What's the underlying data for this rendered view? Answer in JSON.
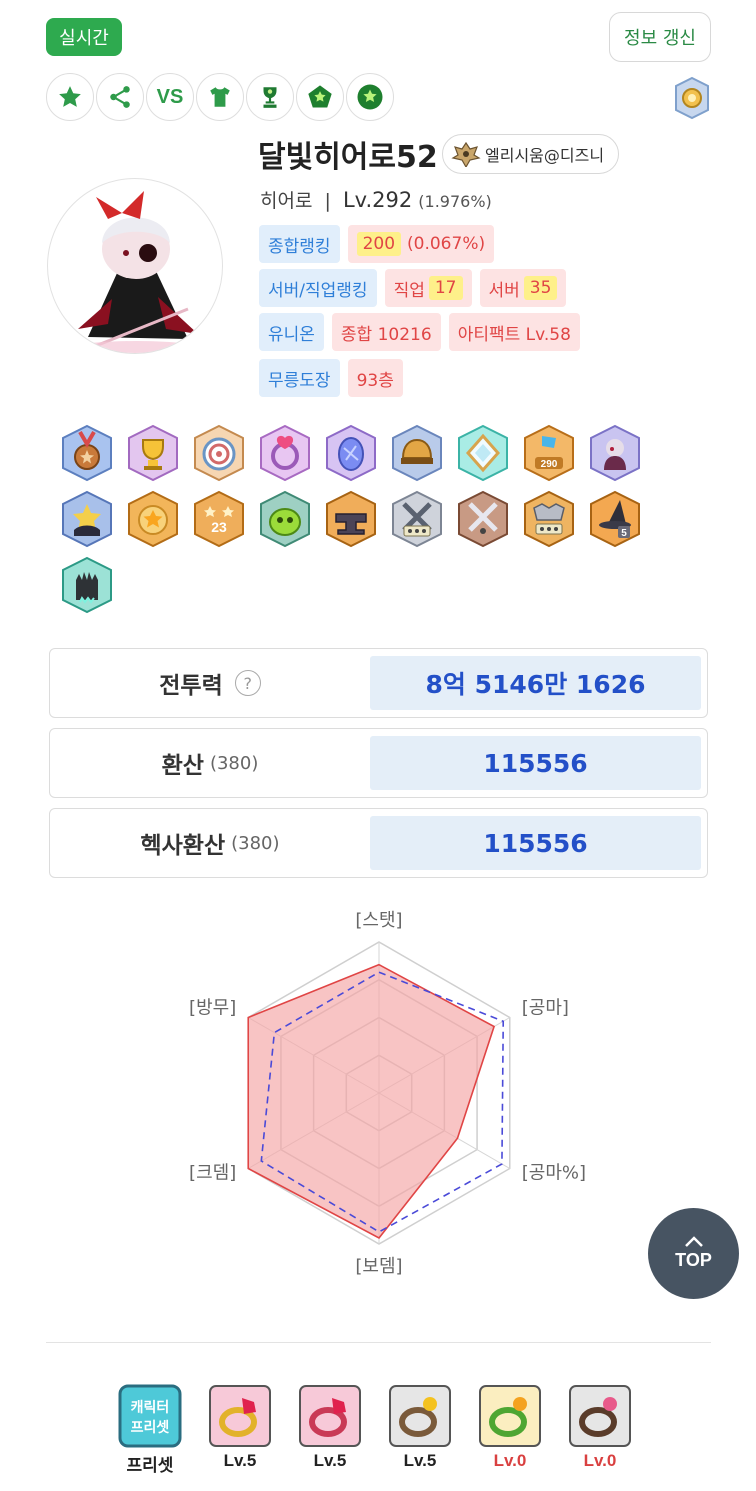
{
  "header": {
    "realtime_label": "실시간",
    "refresh_label": "정보 갱신",
    "quick_icons": [
      {
        "icon": "star-icon"
      },
      {
        "icon": "share-icon"
      },
      {
        "icon": "vs-icon",
        "text": "VS"
      },
      {
        "icon": "shirt-icon"
      },
      {
        "icon": "trophy-icon"
      },
      {
        "icon": "pentagon-icon"
      },
      {
        "icon": "circle-star-icon"
      }
    ]
  },
  "character": {
    "name": "달빛히어로52",
    "guild": "엘리시움@디즈니",
    "job": "히어로",
    "separator": "|",
    "level": "Lv.292",
    "exp_percent": "(1.976%)"
  },
  "rankings": {
    "overall_label": "종합랭킹",
    "overall_rank": "200",
    "overall_percent": "(0.067%)",
    "server_job_label": "서버/직업랭킹",
    "job_label": "직업",
    "job_rank": "17",
    "server_label": "서버",
    "server_rank": "35",
    "union_label": "유니온",
    "union_total": "종합 10216",
    "artifact": "아티팩트 Lv.58",
    "dojang_label": "무릉도장",
    "dojang_floor": "93층"
  },
  "stats": {
    "combat_power_label": "전투력",
    "combat_power_value": "8억 5146만 1626",
    "conversion_label": "환산",
    "conversion_sub": "(380)",
    "conversion_value": "115556",
    "hexa_conversion_label": "헥사환산",
    "hexa_conversion_sub": "(380)",
    "hexa_conversion_value": "115556"
  },
  "chart_data": {
    "type": "radar",
    "axes": [
      "[스탯]",
      "[공마]",
      "[공마%]",
      "[보뎀]",
      "[크뎀]",
      "[방무]"
    ],
    "series": [
      {
        "values": [
          0.85,
          0.88,
          0.6,
          0.96,
          1.0,
          1.0
        ],
        "color": "#e04545",
        "fill": "#f4a5a5"
      },
      {
        "values": [
          0.8,
          0.95,
          0.94,
          0.92,
          0.9,
          0.8
        ],
        "color": "#4a4ad8",
        "dashed": true
      }
    ],
    "rings": 4
  },
  "top_button": {
    "label": "TOP"
  },
  "presets": [
    {
      "icon": "character-preset-icon",
      "label": "프리셋",
      "alert": false
    },
    {
      "icon": "ring-icon",
      "label": "Lv.5",
      "alert": false
    },
    {
      "icon": "ring-icon",
      "label": "Lv.5",
      "alert": false
    },
    {
      "icon": "ring-icon",
      "label": "Lv.5",
      "alert": false
    },
    {
      "icon": "ring-icon",
      "label": "Lv.0",
      "alert": true
    },
    {
      "icon": "ring-icon",
      "label": "Lv.0",
      "alert": true
    }
  ],
  "colors": {
    "accent_green": "#2eaa4f",
    "rank_blue": "#2f7fd8",
    "rank_red": "#e04545",
    "value_blue": "#2350c8"
  }
}
